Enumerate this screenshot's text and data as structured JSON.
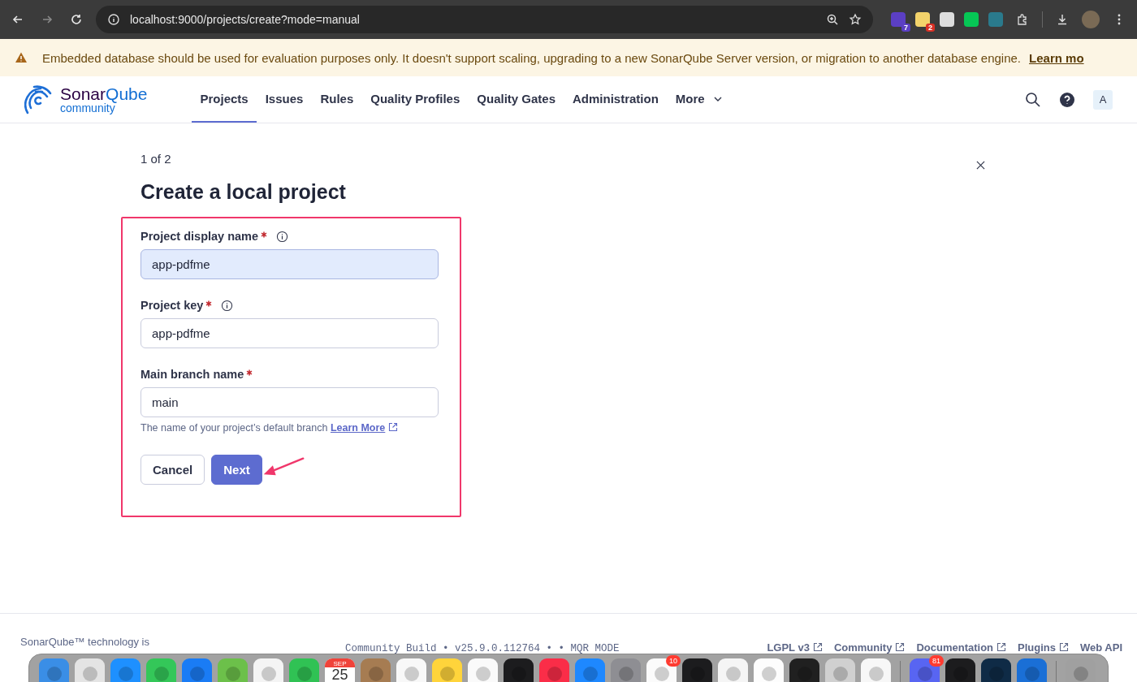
{
  "browser": {
    "url": "localhost:9000/projects/create?mode=manual",
    "extension_badges": [
      "7",
      "2"
    ]
  },
  "banner": {
    "message": "Embedded database should be used for evaluation purposes only. It doesn't support scaling, upgrading to a new SonarQube Server version, or migration to another database engine.",
    "link": "Learn mo"
  },
  "header": {
    "logo": {
      "name_dark": "Sonar",
      "name_light": "Qube",
      "edition": "community"
    },
    "nav": [
      {
        "label": "Projects",
        "selected": true,
        "kind": "link"
      },
      {
        "label": "Issues",
        "selected": false,
        "kind": "link"
      },
      {
        "label": "Rules",
        "selected": false,
        "kind": "link"
      },
      {
        "label": "Quality Profiles",
        "selected": false,
        "kind": "link"
      },
      {
        "label": "Quality Gates",
        "selected": false,
        "kind": "link"
      },
      {
        "label": "Administration",
        "selected": false,
        "kind": "link"
      },
      {
        "label": "More",
        "selected": false,
        "kind": "dropdown"
      }
    ],
    "avatar": "A"
  },
  "page": {
    "step": "1 of 2",
    "title": "Create a local project",
    "fields": [
      {
        "label": "Project display name",
        "required": true,
        "info": true,
        "value": "app-pdfme",
        "autofilled": true
      },
      {
        "label": "Project key",
        "required": true,
        "info": true,
        "value": "app-pdfme",
        "autofilled": false
      },
      {
        "label": "Main branch name",
        "required": true,
        "info": false,
        "value": "main",
        "autofilled": false
      }
    ],
    "hint": {
      "text": "The name of your project’s default branch",
      "link": "Learn More"
    },
    "buttons": [
      {
        "label": "Cancel",
        "kind": "secondary"
      },
      {
        "label": "Next",
        "kind": "primary"
      }
    ]
  },
  "footer": {
    "left": [
      "SonarQube™ technology is"
    ],
    "build": "Community Build • v25.9.0.112764 • • MQR MODE",
    "links": [
      {
        "label": "LGPL v3",
        "external": true
      },
      {
        "label": "Community",
        "external": true
      },
      {
        "label": "Documentation",
        "external": true
      },
      {
        "label": "Plugins",
        "external": true
      },
      {
        "label": "Web API",
        "external": false
      }
    ]
  },
  "dock": [
    {
      "kind": "app",
      "color": "#3a8ee6"
    },
    {
      "kind": "app",
      "color": "#e4e4e4"
    },
    {
      "kind": "app",
      "color": "#1e90ff"
    },
    {
      "kind": "app",
      "color": "#34c759"
    },
    {
      "kind": "app",
      "color": "#1a7cf5"
    },
    {
      "kind": "app",
      "color": "#6cc04a"
    },
    {
      "kind": "app",
      "color": "#f4f4f4"
    },
    {
      "kind": "app",
      "color": "#30c254"
    },
    {
      "kind": "calendar",
      "month": "SEP",
      "day": "25"
    },
    {
      "kind": "app",
      "color": "#a67c52"
    },
    {
      "kind": "app",
      "color": "#f8f8f8"
    },
    {
      "kind": "app",
      "color": "#ffd43b"
    },
    {
      "kind": "app",
      "color": "#fafafa"
    },
    {
      "kind": "app",
      "color": "#1c1c1e"
    },
    {
      "kind": "app",
      "color": "#fa2d48"
    },
    {
      "kind": "app",
      "color": "#1e88ff"
    },
    {
      "kind": "app",
      "color": "#8e8e93"
    },
    {
      "kind": "app",
      "color": "#fbfbfb",
      "badge": "10"
    },
    {
      "kind": "app",
      "color": "#1c1c1e"
    },
    {
      "kind": "app",
      "color": "#f5f5f5"
    },
    {
      "kind": "app",
      "color": "#fdfdfd"
    },
    {
      "kind": "app",
      "color": "#202020"
    },
    {
      "kind": "app",
      "color": "#d0d0d0"
    },
    {
      "kind": "app",
      "color": "#f7f7f7"
    },
    {
      "kind": "separator"
    },
    {
      "kind": "app",
      "color": "#5865f2",
      "badge": "81"
    },
    {
      "kind": "app",
      "color": "#1c1c1e"
    },
    {
      "kind": "app",
      "color": "#0f2b46"
    },
    {
      "kind": "app",
      "color": "#1a6fd6"
    },
    {
      "kind": "separator"
    },
    {
      "kind": "app",
      "color": "#a0a0a0"
    }
  ]
}
